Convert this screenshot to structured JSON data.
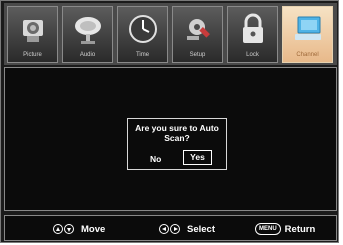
{
  "tabs": [
    {
      "label": "Picture",
      "icon": "camera-icon"
    },
    {
      "label": "Audio",
      "icon": "satellite-dish-icon"
    },
    {
      "label": "Time",
      "icon": "clock-icon"
    },
    {
      "label": "Setup",
      "icon": "tools-icon"
    },
    {
      "label": "Lock",
      "icon": "lock-icon"
    },
    {
      "label": "Channel",
      "icon": "computer-icon"
    }
  ],
  "active_tab": "Channel",
  "dialog": {
    "message": "Are you sure to Auto Scan?",
    "no_label": "No",
    "yes_label": "Yes"
  },
  "footer": {
    "move_label": "Move",
    "select_label": "Select",
    "menu_key": "MENU",
    "return_label": "Return"
  },
  "colors": {
    "background": "#0b0b0b",
    "active_tab": "#f0c9a0",
    "text": "#ffffff"
  }
}
